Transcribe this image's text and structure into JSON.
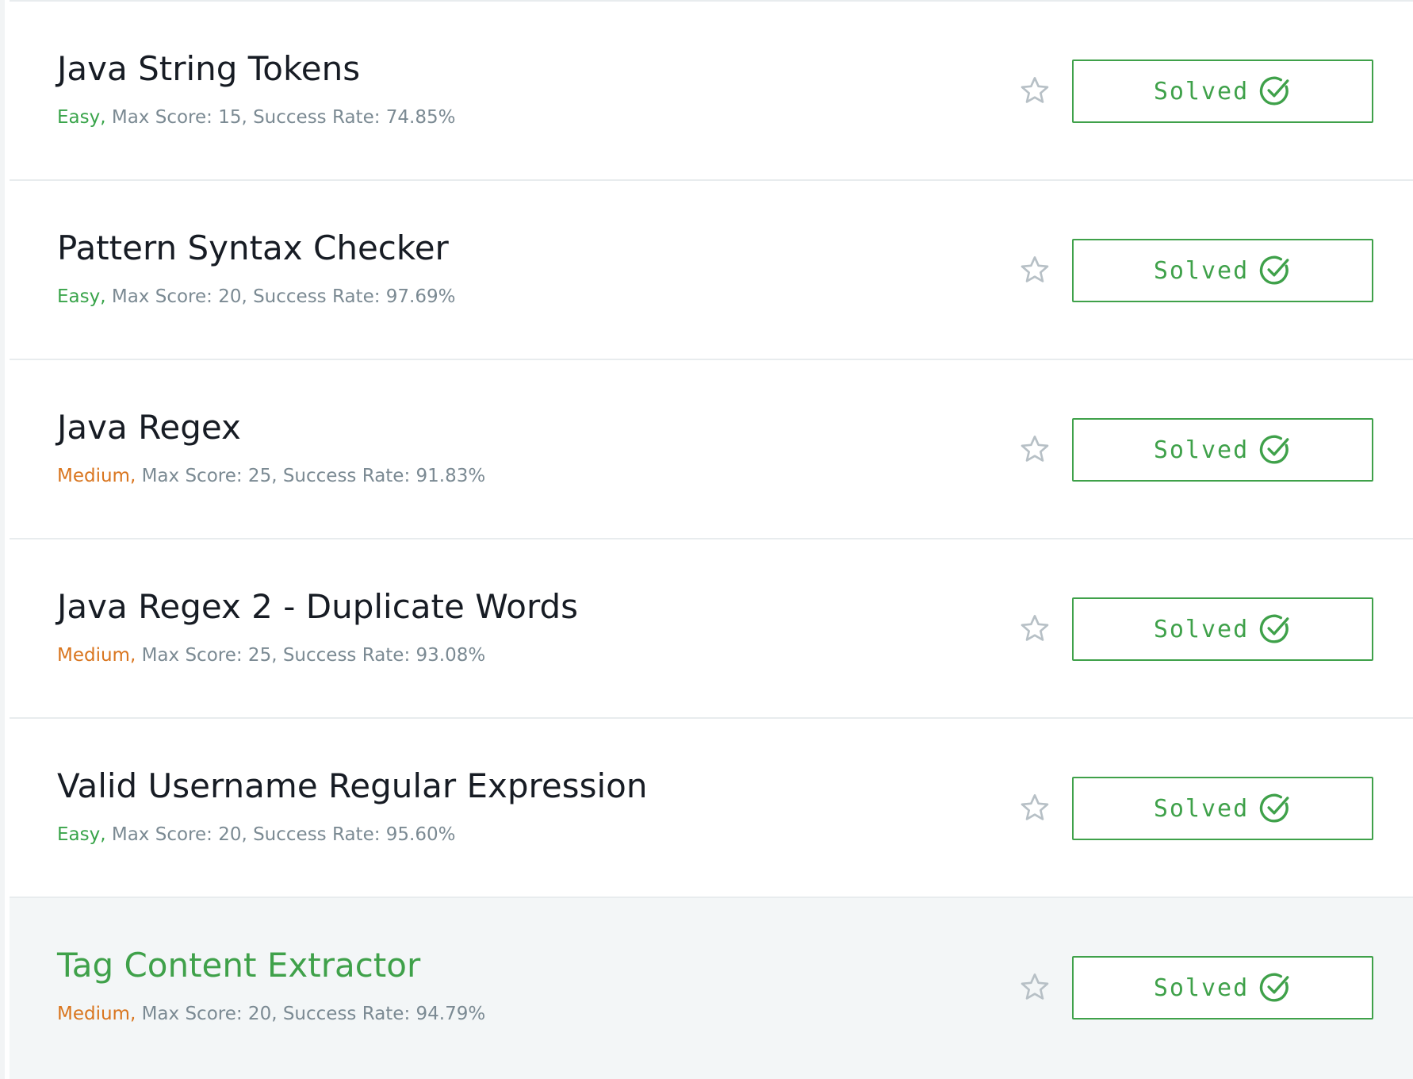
{
  "challenges": [
    {
      "title": "Java String Tokens",
      "difficulty": "Easy,",
      "difficulty_level": "easy",
      "stats": " Max Score: 15, Success Rate: 74.85%",
      "status": "Solved"
    },
    {
      "title": "Pattern Syntax Checker",
      "difficulty": "Easy,",
      "difficulty_level": "easy",
      "stats": " Max Score: 20, Success Rate: 97.69%",
      "status": "Solved"
    },
    {
      "title": "Java Regex",
      "difficulty": "Medium,",
      "difficulty_level": "medium",
      "stats": " Max Score: 25, Success Rate: 91.83%",
      "status": "Solved"
    },
    {
      "title": "Java Regex 2 - Duplicate Words",
      "difficulty": "Medium,",
      "difficulty_level": "medium",
      "stats": " Max Score: 25, Success Rate: 93.08%",
      "status": "Solved"
    },
    {
      "title": "Valid Username Regular Expression",
      "difficulty": "Easy,",
      "difficulty_level": "easy",
      "stats": " Max Score: 20, Success Rate: 95.60%",
      "status": "Solved"
    },
    {
      "title": "Tag Content Extractor",
      "difficulty": "Medium,",
      "difficulty_level": "medium",
      "stats": " Max Score: 20, Success Rate: 94.79%",
      "status": "Solved",
      "hovered": true
    }
  ],
  "colors": {
    "easy": "#39a44a",
    "medium": "#d9751e",
    "meta_text": "#7b8a93",
    "solved": "#3fa14a",
    "title_text": "#171c24",
    "hover_background": "#f3f6f7",
    "star_outline": "#b7c0c6"
  },
  "icons": {
    "star": "star-outline-icon",
    "solved": "check-circle-icon"
  }
}
